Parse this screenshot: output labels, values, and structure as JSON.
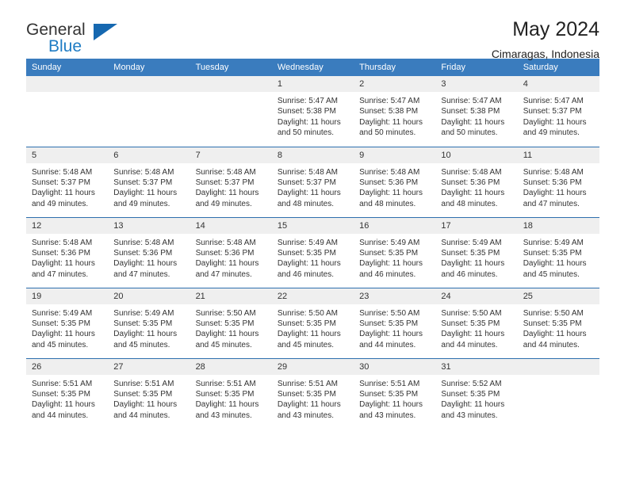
{
  "brand": {
    "name_part1": "General",
    "name_part2": "Blue",
    "triangle_icon": "triangle-icon"
  },
  "header": {
    "title": "May 2024",
    "subtitle": "Cimaragas, Indonesia"
  },
  "colors": {
    "header_blue": "#3a7cbe",
    "row_rule_blue": "#2d6fae",
    "daynum_bg": "#efefef",
    "brand_blue": "#1f7cc4",
    "text": "#333333"
  },
  "weekday_headers": [
    "Sunday",
    "Monday",
    "Tuesday",
    "Wednesday",
    "Thursday",
    "Friday",
    "Saturday"
  ],
  "labels": {
    "sunrise": "Sunrise:",
    "sunset": "Sunset:",
    "daylight": "Daylight:"
  },
  "weeks": [
    [
      {
        "day": "",
        "empty": true
      },
      {
        "day": "",
        "empty": true
      },
      {
        "day": "",
        "empty": true
      },
      {
        "day": "1",
        "sunrise": "Sunrise: 5:47 AM",
        "sunset": "Sunset: 5:38 PM",
        "daylight_l1": "Daylight: 11 hours",
        "daylight_l2": "and 50 minutes."
      },
      {
        "day": "2",
        "sunrise": "Sunrise: 5:47 AM",
        "sunset": "Sunset: 5:38 PM",
        "daylight_l1": "Daylight: 11 hours",
        "daylight_l2": "and 50 minutes."
      },
      {
        "day": "3",
        "sunrise": "Sunrise: 5:47 AM",
        "sunset": "Sunset: 5:38 PM",
        "daylight_l1": "Daylight: 11 hours",
        "daylight_l2": "and 50 minutes."
      },
      {
        "day": "4",
        "sunrise": "Sunrise: 5:47 AM",
        "sunset": "Sunset: 5:37 PM",
        "daylight_l1": "Daylight: 11 hours",
        "daylight_l2": "and 49 minutes."
      }
    ],
    [
      {
        "day": "5",
        "sunrise": "Sunrise: 5:48 AM",
        "sunset": "Sunset: 5:37 PM",
        "daylight_l1": "Daylight: 11 hours",
        "daylight_l2": "and 49 minutes."
      },
      {
        "day": "6",
        "sunrise": "Sunrise: 5:48 AM",
        "sunset": "Sunset: 5:37 PM",
        "daylight_l1": "Daylight: 11 hours",
        "daylight_l2": "and 49 minutes."
      },
      {
        "day": "7",
        "sunrise": "Sunrise: 5:48 AM",
        "sunset": "Sunset: 5:37 PM",
        "daylight_l1": "Daylight: 11 hours",
        "daylight_l2": "and 49 minutes."
      },
      {
        "day": "8",
        "sunrise": "Sunrise: 5:48 AM",
        "sunset": "Sunset: 5:37 PM",
        "daylight_l1": "Daylight: 11 hours",
        "daylight_l2": "and 48 minutes."
      },
      {
        "day": "9",
        "sunrise": "Sunrise: 5:48 AM",
        "sunset": "Sunset: 5:36 PM",
        "daylight_l1": "Daylight: 11 hours",
        "daylight_l2": "and 48 minutes."
      },
      {
        "day": "10",
        "sunrise": "Sunrise: 5:48 AM",
        "sunset": "Sunset: 5:36 PM",
        "daylight_l1": "Daylight: 11 hours",
        "daylight_l2": "and 48 minutes."
      },
      {
        "day": "11",
        "sunrise": "Sunrise: 5:48 AM",
        "sunset": "Sunset: 5:36 PM",
        "daylight_l1": "Daylight: 11 hours",
        "daylight_l2": "and 47 minutes."
      }
    ],
    [
      {
        "day": "12",
        "sunrise": "Sunrise: 5:48 AM",
        "sunset": "Sunset: 5:36 PM",
        "daylight_l1": "Daylight: 11 hours",
        "daylight_l2": "and 47 minutes."
      },
      {
        "day": "13",
        "sunrise": "Sunrise: 5:48 AM",
        "sunset": "Sunset: 5:36 PM",
        "daylight_l1": "Daylight: 11 hours",
        "daylight_l2": "and 47 minutes."
      },
      {
        "day": "14",
        "sunrise": "Sunrise: 5:48 AM",
        "sunset": "Sunset: 5:36 PM",
        "daylight_l1": "Daylight: 11 hours",
        "daylight_l2": "and 47 minutes."
      },
      {
        "day": "15",
        "sunrise": "Sunrise: 5:49 AM",
        "sunset": "Sunset: 5:35 PM",
        "daylight_l1": "Daylight: 11 hours",
        "daylight_l2": "and 46 minutes."
      },
      {
        "day": "16",
        "sunrise": "Sunrise: 5:49 AM",
        "sunset": "Sunset: 5:35 PM",
        "daylight_l1": "Daylight: 11 hours",
        "daylight_l2": "and 46 minutes."
      },
      {
        "day": "17",
        "sunrise": "Sunrise: 5:49 AM",
        "sunset": "Sunset: 5:35 PM",
        "daylight_l1": "Daylight: 11 hours",
        "daylight_l2": "and 46 minutes."
      },
      {
        "day": "18",
        "sunrise": "Sunrise: 5:49 AM",
        "sunset": "Sunset: 5:35 PM",
        "daylight_l1": "Daylight: 11 hours",
        "daylight_l2": "and 45 minutes."
      }
    ],
    [
      {
        "day": "19",
        "sunrise": "Sunrise: 5:49 AM",
        "sunset": "Sunset: 5:35 PM",
        "daylight_l1": "Daylight: 11 hours",
        "daylight_l2": "and 45 minutes."
      },
      {
        "day": "20",
        "sunrise": "Sunrise: 5:49 AM",
        "sunset": "Sunset: 5:35 PM",
        "daylight_l1": "Daylight: 11 hours",
        "daylight_l2": "and 45 minutes."
      },
      {
        "day": "21",
        "sunrise": "Sunrise: 5:50 AM",
        "sunset": "Sunset: 5:35 PM",
        "daylight_l1": "Daylight: 11 hours",
        "daylight_l2": "and 45 minutes."
      },
      {
        "day": "22",
        "sunrise": "Sunrise: 5:50 AM",
        "sunset": "Sunset: 5:35 PM",
        "daylight_l1": "Daylight: 11 hours",
        "daylight_l2": "and 45 minutes."
      },
      {
        "day": "23",
        "sunrise": "Sunrise: 5:50 AM",
        "sunset": "Sunset: 5:35 PM",
        "daylight_l1": "Daylight: 11 hours",
        "daylight_l2": "and 44 minutes."
      },
      {
        "day": "24",
        "sunrise": "Sunrise: 5:50 AM",
        "sunset": "Sunset: 5:35 PM",
        "daylight_l1": "Daylight: 11 hours",
        "daylight_l2": "and 44 minutes."
      },
      {
        "day": "25",
        "sunrise": "Sunrise: 5:50 AM",
        "sunset": "Sunset: 5:35 PM",
        "daylight_l1": "Daylight: 11 hours",
        "daylight_l2": "and 44 minutes."
      }
    ],
    [
      {
        "day": "26",
        "sunrise": "Sunrise: 5:51 AM",
        "sunset": "Sunset: 5:35 PM",
        "daylight_l1": "Daylight: 11 hours",
        "daylight_l2": "and 44 minutes."
      },
      {
        "day": "27",
        "sunrise": "Sunrise: 5:51 AM",
        "sunset": "Sunset: 5:35 PM",
        "daylight_l1": "Daylight: 11 hours",
        "daylight_l2": "and 44 minutes."
      },
      {
        "day": "28",
        "sunrise": "Sunrise: 5:51 AM",
        "sunset": "Sunset: 5:35 PM",
        "daylight_l1": "Daylight: 11 hours",
        "daylight_l2": "and 43 minutes."
      },
      {
        "day": "29",
        "sunrise": "Sunrise: 5:51 AM",
        "sunset": "Sunset: 5:35 PM",
        "daylight_l1": "Daylight: 11 hours",
        "daylight_l2": "and 43 minutes."
      },
      {
        "day": "30",
        "sunrise": "Sunrise: 5:51 AM",
        "sunset": "Sunset: 5:35 PM",
        "daylight_l1": "Daylight: 11 hours",
        "daylight_l2": "and 43 minutes."
      },
      {
        "day": "31",
        "sunrise": "Sunrise: 5:52 AM",
        "sunset": "Sunset: 5:35 PM",
        "daylight_l1": "Daylight: 11 hours",
        "daylight_l2": "and 43 minutes."
      },
      {
        "day": "",
        "empty": true
      }
    ]
  ]
}
